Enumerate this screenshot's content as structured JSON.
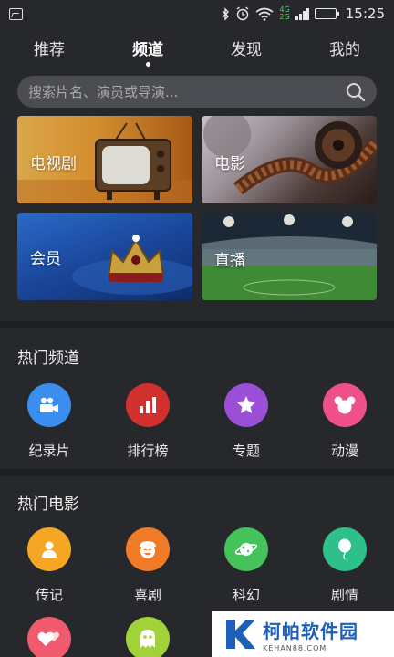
{
  "status_bar": {
    "time": "15:25",
    "network_top": "4G",
    "network_bottom": "2G"
  },
  "tabs": [
    {
      "label": "推荐",
      "active": false
    },
    {
      "label": "频道",
      "active": true
    },
    {
      "label": "发现",
      "active": false
    },
    {
      "label": "我的",
      "active": false
    }
  ],
  "search": {
    "placeholder": "搜索片名、演员或导演..."
  },
  "categories": [
    {
      "label": "电视剧"
    },
    {
      "label": "电影"
    },
    {
      "label": "会员"
    },
    {
      "label": "直播"
    }
  ],
  "hot_channels": {
    "title": "热门频道",
    "items": [
      {
        "label": "纪录片",
        "icon": "camcorder-icon",
        "color": "#3a8ef0"
      },
      {
        "label": "排行榜",
        "icon": "bar-chart-icon",
        "color": "#d2302e"
      },
      {
        "label": "专题",
        "icon": "star-icon",
        "color": "#9b4fd6"
      },
      {
        "label": "动漫",
        "icon": "mickey-icon",
        "color": "#f0508a"
      }
    ]
  },
  "hot_movies": {
    "title": "热门电影",
    "items": [
      {
        "label": "传记",
        "icon": "person-icon",
        "color": "#f5a623"
      },
      {
        "label": "喜剧",
        "icon": "laughing-face-icon",
        "color": "#f07a26"
      },
      {
        "label": "科幻",
        "icon": "planet-icon",
        "color": "#45c25a"
      },
      {
        "label": "剧情",
        "icon": "balloon-icon",
        "color": "#2dc08a"
      },
      {
        "icon": "hearts-icon",
        "color": "#ef5b6c"
      },
      {
        "icon": "ghost-icon",
        "color": "#a2d23a"
      }
    ]
  },
  "watermark": {
    "title": "柯帕软件园",
    "url": "KEHAN88.COM"
  }
}
